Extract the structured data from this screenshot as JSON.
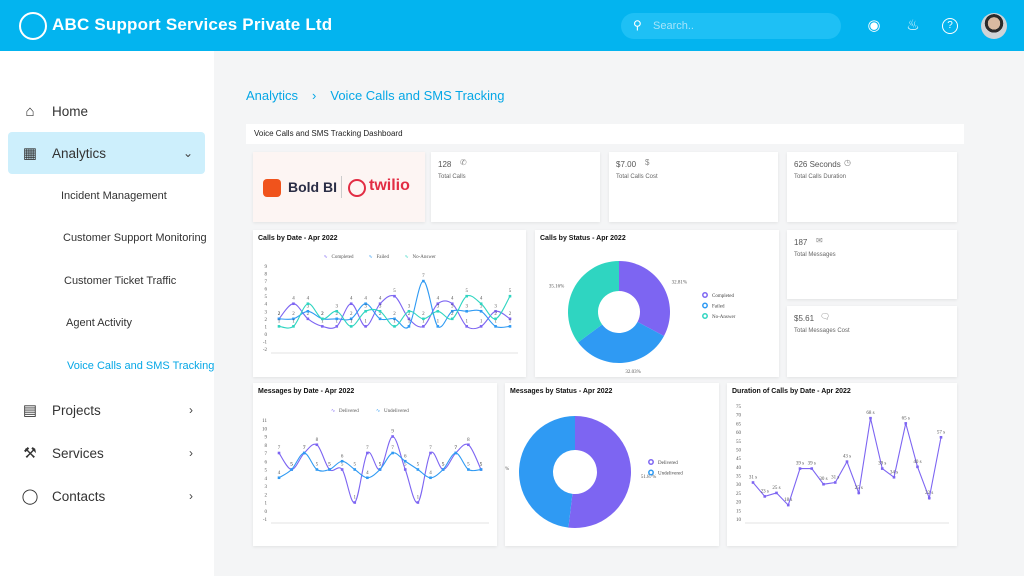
{
  "header": {
    "title": "ABC Support Services Private Ltd",
    "search_placeholder": "Search..",
    "icons": [
      "location-icon",
      "bell-icon",
      "help-icon"
    ]
  },
  "sidebar": {
    "items": [
      {
        "label": "Home",
        "icon": "home-icon"
      },
      {
        "label": "Analytics",
        "icon": "dashboard-icon",
        "expanded": true,
        "children": [
          "Incident Management",
          "Customer Support Monitoring",
          "Customer Ticket Traffic",
          "Agent Activity",
          "Voice Calls and SMS Tracking"
        ]
      },
      {
        "label": "Projects",
        "icon": "clipboard-icon"
      },
      {
        "label": "Services",
        "icon": "wrench-icon"
      },
      {
        "label": "Contacts",
        "icon": "contact-icon"
      }
    ]
  },
  "breadcrumb": [
    "Analytics",
    "Voice Calls and SMS Tracking"
  ],
  "dashboard": {
    "title": "Voice Calls and SMS Tracking Dashboard",
    "logos": [
      "Bold BI",
      "twilio"
    ],
    "kpis": [
      {
        "value": "128",
        "label": "Total Calls",
        "icon": "phone-icon"
      },
      {
        "value": "$7.00",
        "label": "Total Calls Cost",
        "icon": "dollar-icon"
      },
      {
        "value": "626 Seconds",
        "label": "Total Calls Duration",
        "icon": "clock-icon"
      },
      {
        "value": "187",
        "label": "Total Messages",
        "icon": "mail-icon"
      },
      {
        "value": "$5.61",
        "label": "Total Messages Cost",
        "icon": "chat-icon"
      }
    ]
  },
  "colors": {
    "accent": "#03b4ef",
    "purple": "#7d65f2",
    "blue": "#2f9af3",
    "teal": "#2fd5c1"
  },
  "chart_data": [
    {
      "type": "line",
      "title": "Calls by Date - Apr 2022",
      "ylim": [
        -2,
        9
      ],
      "yticks": [
        -2,
        -1,
        0,
        1,
        2,
        3,
        4,
        5,
        6,
        7,
        8,
        9
      ],
      "smooth": true,
      "legend": "top",
      "series": [
        {
          "name": "Completed",
          "color": "#7d65f2",
          "values": [
            2,
            4,
            2,
            1,
            1,
            4,
            1,
            4,
            5,
            2,
            1,
            4,
            4,
            1,
            1,
            3,
            2
          ]
        },
        {
          "name": "Failed",
          "color": "#2f9af3",
          "values": [
            2,
            2,
            3,
            2,
            2,
            2,
            4,
            2,
            2,
            1,
            7,
            1,
            3,
            3,
            3,
            1,
            1
          ]
        },
        {
          "name": "No-Answer",
          "color": "#2fd5c1",
          "values": [
            1,
            1,
            4,
            2,
            3,
            1,
            3,
            3,
            1,
            3,
            2,
            3,
            2,
            5,
            4,
            2,
            5
          ]
        }
      ]
    },
    {
      "type": "pie",
      "title": "Calls by Status - Apr 2022",
      "legend": "right",
      "categories": [
        "Completed",
        "Failed",
        "No-Answer"
      ],
      "values": [
        32.81,
        32.03,
        35.16
      ],
      "labels": [
        "32.81%",
        "32.03%",
        "35.16%"
      ],
      "colors": [
        "#7d65f2",
        "#2f9af3",
        "#2fd5c1"
      ]
    },
    {
      "type": "line",
      "title": "Messages by Date - Apr 2022",
      "ylim": [
        -1,
        11
      ],
      "yticks": [
        -1,
        0,
        1,
        2,
        3,
        4,
        5,
        6,
        7,
        8,
        9,
        10,
        11
      ],
      "smooth": true,
      "legend": "top",
      "series": [
        {
          "name": "Delivered",
          "color": "#7d65f2",
          "values": [
            7,
            5,
            7,
            8,
            5,
            5,
            1,
            7,
            5,
            9,
            5,
            1,
            7,
            5,
            7,
            8,
            5
          ]
        },
        {
          "name": "Undelivered",
          "color": "#2f9af3",
          "values": [
            4,
            5,
            7,
            5,
            5,
            6,
            5,
            4,
            5,
            7,
            6,
            5,
            4,
            5,
            7,
            5,
            5
          ]
        }
      ]
    },
    {
      "type": "pie",
      "title": "Messages by Status - Apr 2022",
      "legend": "right",
      "categories": [
        "Delivered",
        "Undelivered"
      ],
      "values": [
        51.87,
        48.13
      ],
      "labels": [
        "51.87%",
        "48.13%"
      ],
      "colors": [
        "#7d65f2",
        "#2f9af3"
      ]
    },
    {
      "type": "line",
      "title": "Duration of Calls by Date - Apr 2022",
      "ylim": [
        10,
        75
      ],
      "yticks": [
        10,
        15,
        20,
        25,
        30,
        35,
        40,
        45,
        50,
        55,
        60,
        65,
        70,
        75
      ],
      "smooth": false,
      "legend": "none",
      "label_suffix": " s",
      "series": [
        {
          "color": "#7d65f2",
          "values": [
            31,
            23,
            25,
            18,
            39,
            39,
            30,
            31,
            43,
            25,
            68,
            39,
            34,
            65,
            40,
            22,
            57
          ]
        }
      ]
    }
  ]
}
